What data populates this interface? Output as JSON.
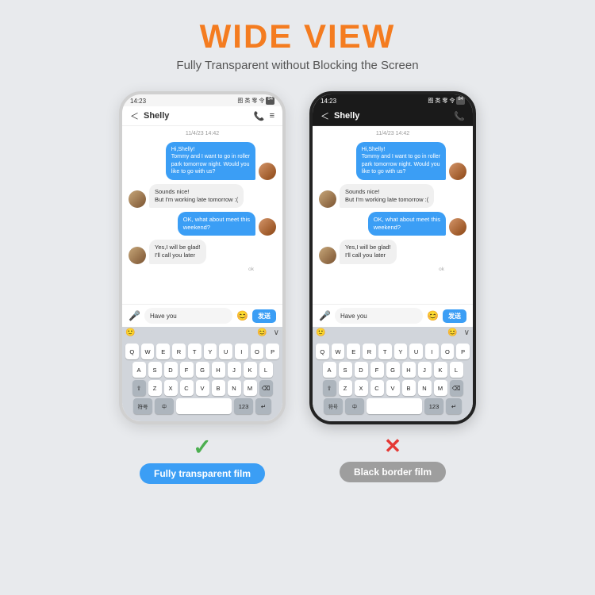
{
  "header": {
    "title": "WIDE VIEW",
    "subtitle": "Fully Transparent without Blocking the Screen"
  },
  "left_phone": {
    "status_time": "14:23",
    "status_icons": "图 类 零 令 84",
    "chat_name": "Shelly",
    "date_label": "11/4/23 14:42",
    "messages": [
      {
        "side": "right",
        "text": "Hi,Shelly!\nTommy and I want to go in roller\npark tomorrow night. Would you\nlike to go with us?"
      },
      {
        "side": "left",
        "text": "Sounds nice!\nBut I'm working late tomorrow :("
      },
      {
        "side": "right",
        "text": "OK, what about meet this\nweekend?"
      },
      {
        "side": "left",
        "text": "Yes,I will be glad!\nI'll call you later"
      }
    ],
    "ok_status": "ok",
    "input_text": "Have you",
    "send_label": "发送",
    "keyboard_rows": [
      [
        "Q",
        "W",
        "E",
        "R",
        "T",
        "Y",
        "U",
        "I",
        "O",
        "P"
      ],
      [
        "A",
        "S",
        "D",
        "F",
        "G",
        "H",
        "J",
        "K",
        "L"
      ],
      [
        "Z",
        "X",
        "C",
        "V",
        "B",
        "N",
        "M"
      ]
    ],
    "fn_keys": [
      "符号",
      "中",
      "↑",
      "⌫",
      "123",
      "⏎"
    ]
  },
  "right_phone": {
    "status_time": "14:23",
    "status_icons": "图 类 零 令 84",
    "chat_name": "Shelly",
    "date_label": "11/4/23 14:42",
    "messages": [
      {
        "side": "right",
        "text": "Hi,Shelly!\nTommy and I want to go in roller\npark tomorrow night. Would you\nlike to go with us?"
      },
      {
        "side": "left",
        "text": "Sounds nice!\nBut I'm working late tomorrow :("
      },
      {
        "side": "right",
        "text": "OK, what about meet this\nweekend?"
      },
      {
        "side": "left",
        "text": "Yes,I will be glad!\nI'll call you later"
      }
    ],
    "ok_status": "ok",
    "input_text": "Have you",
    "send_label": "发送"
  },
  "labels": {
    "left_check": "✓",
    "left_label": "Fully transparent film",
    "right_cross": "✕",
    "right_label": "Black border film"
  }
}
